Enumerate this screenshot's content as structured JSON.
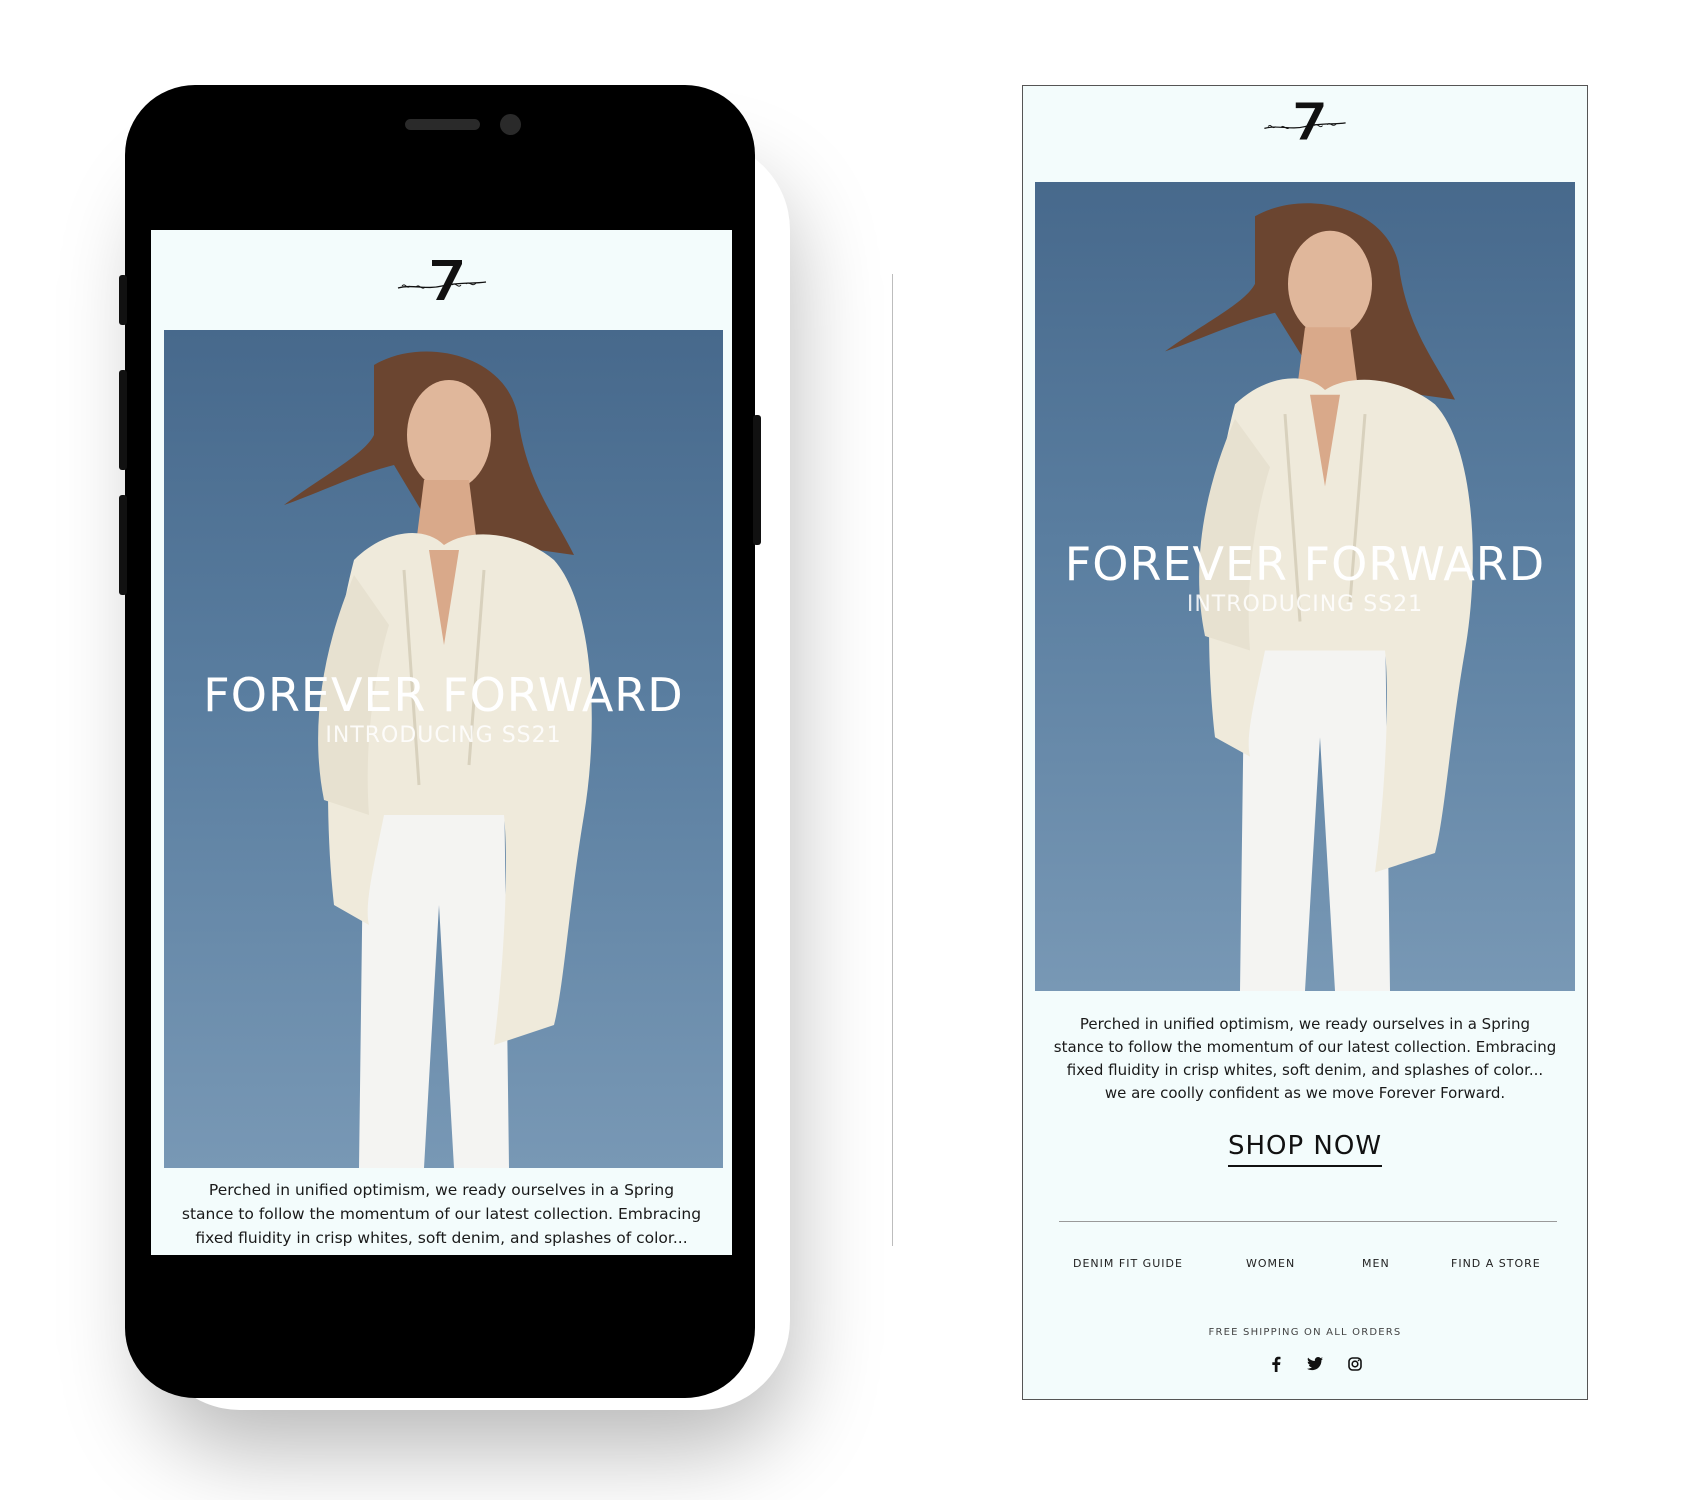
{
  "brand": {
    "logo_text": "for all mankind",
    "logo_numeral": "7"
  },
  "email": {
    "headline": "FOREVER FORWARD",
    "subheadline": "INTRODUCING SS21",
    "body_lines": [
      "Perched in unified optimism, we ready ourselves in a Spring",
      "stance to follow the momentum of our latest collection. Embracing",
      "fixed fluidity in crisp whites, soft denim, and splashes of color...",
      "we are coolly confident as we move Forever Forward."
    ],
    "cta_label": "SHOP NOW",
    "nav": [
      "DENIM FIT GUIDE",
      "WOMEN",
      "MEN",
      "FIND A STORE"
    ],
    "footer_note": "FREE SHIPPING ON ALL ORDERS",
    "social": [
      "facebook-icon",
      "twitter-icon",
      "instagram-icon"
    ]
  },
  "colors": {
    "email_bg": "#f3fcfc",
    "sky_top": "#47698c",
    "sky_bottom": "#7898b5",
    "text": "#1a1a1a"
  }
}
